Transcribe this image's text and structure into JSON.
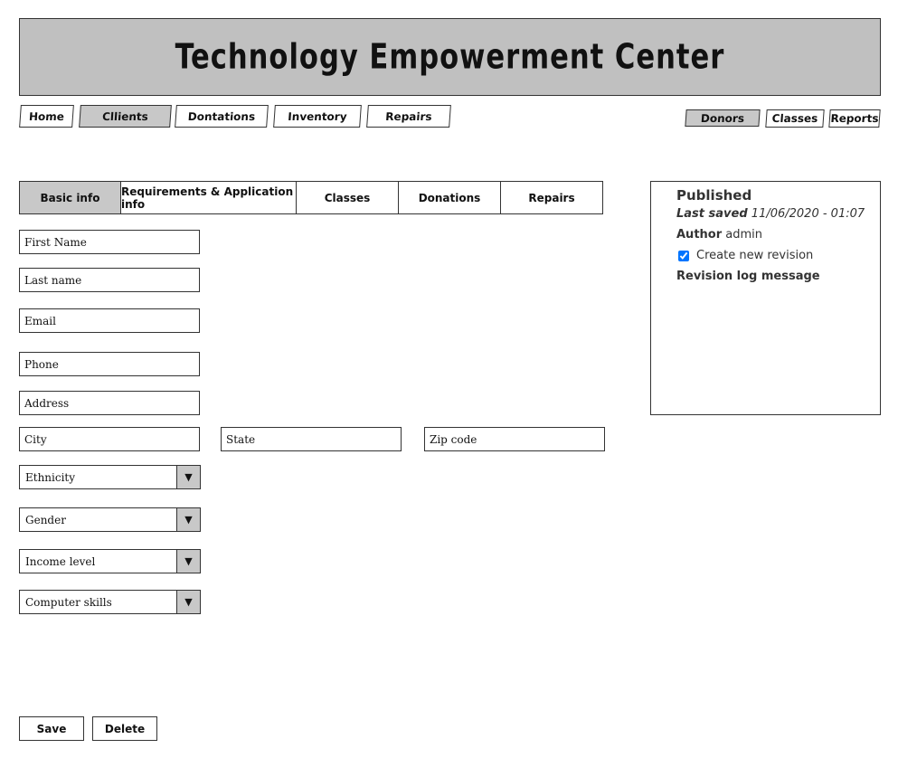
{
  "header": {
    "title": "Technology Empowerment Center"
  },
  "nav_left": [
    "Home",
    "Cllients",
    "Dontations",
    "Inventory",
    "Repairs"
  ],
  "nav_right": [
    "Donors",
    "Classes",
    "Reports"
  ],
  "tabs": [
    "Basic info",
    "Requirements & Application info",
    "Classes",
    "Donations",
    "Repairs"
  ],
  "form": {
    "first_name_placeholder": "First Name",
    "last_name_placeholder": "Last name",
    "email_placeholder": "Email",
    "phone_placeholder": "Phone",
    "address_placeholder": "Address",
    "city_placeholder": "City",
    "state_placeholder": "State",
    "zip_placeholder": "Zip code",
    "ethnicity_label": "Ethnicity",
    "gender_label": "Gender",
    "income_label": "Income level",
    "computer_skills_label": "Computer skills",
    "dropdown_icon": "▼"
  },
  "panel": {
    "status": "Published",
    "last_saved_label": "Last saved",
    "last_saved_value": "11/06/2020 - 01:07",
    "author_label": "Author",
    "author_value": "admin",
    "revision_checkbox_label": "Create new revision",
    "revision_checked": true,
    "revision_log_label": "Revision log message"
  },
  "actions": {
    "save_label": "Save",
    "delete_label": "Delete"
  },
  "colors": {
    "header_bg": "#c0c0c0",
    "active_bg": "#c8c8c8",
    "border": "#333333"
  }
}
